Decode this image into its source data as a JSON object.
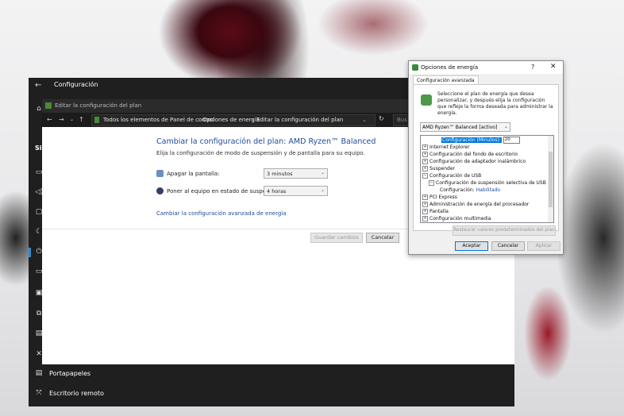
{
  "settings": {
    "title": "Configuración",
    "side_heading": "Sis",
    "side_items": [
      {
        "label": "Portapapeles",
        "icon": "clipboard-icon"
      },
      {
        "label": "Escritorio remoto",
        "icon": "remote-desktop-icon"
      }
    ],
    "accent_color": "#2b8ad8"
  },
  "control_panel": {
    "title": "Editar la configuración del plan",
    "breadcrumb": [
      "Todos los elementos de Panel de control",
      "Opciones de energía",
      "Editar la configuración del plan"
    ],
    "search_placeholder": "Bus",
    "heading": "Cambiar la configuración del plan: AMD Ryzen™ Balanced",
    "subheading": "Elija la configuración de modo de suspensión y de pantalla para su equipo.",
    "display_off_label": "Apagar la pantalla:",
    "display_off_value": "3 minutos",
    "sleep_label": "Poner al equipo en estado de suspensión:",
    "sleep_value": "4 horas",
    "advanced_link": "Cambiar la configuración avanzada de energía",
    "save_button": "Guardar cambios",
    "cancel_button": "Cancelar"
  },
  "power_dialog": {
    "title": "Opciones de energía",
    "help": "?",
    "close": "✕",
    "tab": "Configuración avanzada",
    "description": "Seleccione el plan de energía que desea personalizar, y después elija la configuración que refleje la forma deseada para administrar la energía.",
    "plan": "AMD Ryzen™ Balanced [activo]",
    "tree": {
      "top_item": "Configuración (Minutos):",
      "top_value": "20",
      "items": [
        {
          "pm": "+",
          "label": "Internet Explorer"
        },
        {
          "pm": "+",
          "label": "Configuración del fondo de escritorio"
        },
        {
          "pm": "+",
          "label": "Configuración de adaptador inalámbrico"
        },
        {
          "pm": "+",
          "label": "Suspender"
        },
        {
          "pm": "−",
          "label": "Configuración de USB"
        }
      ],
      "usb_child": "Configuración de suspensión selectiva de USB",
      "usb_setting_label": "Configuración:",
      "usb_setting_value": "Habilitado",
      "items_after": [
        {
          "pm": "+",
          "label": "PCI Express"
        },
        {
          "pm": "+",
          "label": "Administración de energía del procesador"
        },
        {
          "pm": "+",
          "label": "Pantalla"
        },
        {
          "pm": "+",
          "label": "Configuración multimedia"
        }
      ]
    },
    "restore_button": "Restaurar valores predeterminados del plan",
    "accept_button": "Aceptar",
    "cancel_button": "Cancelar",
    "apply_button": "Aplicar"
  }
}
